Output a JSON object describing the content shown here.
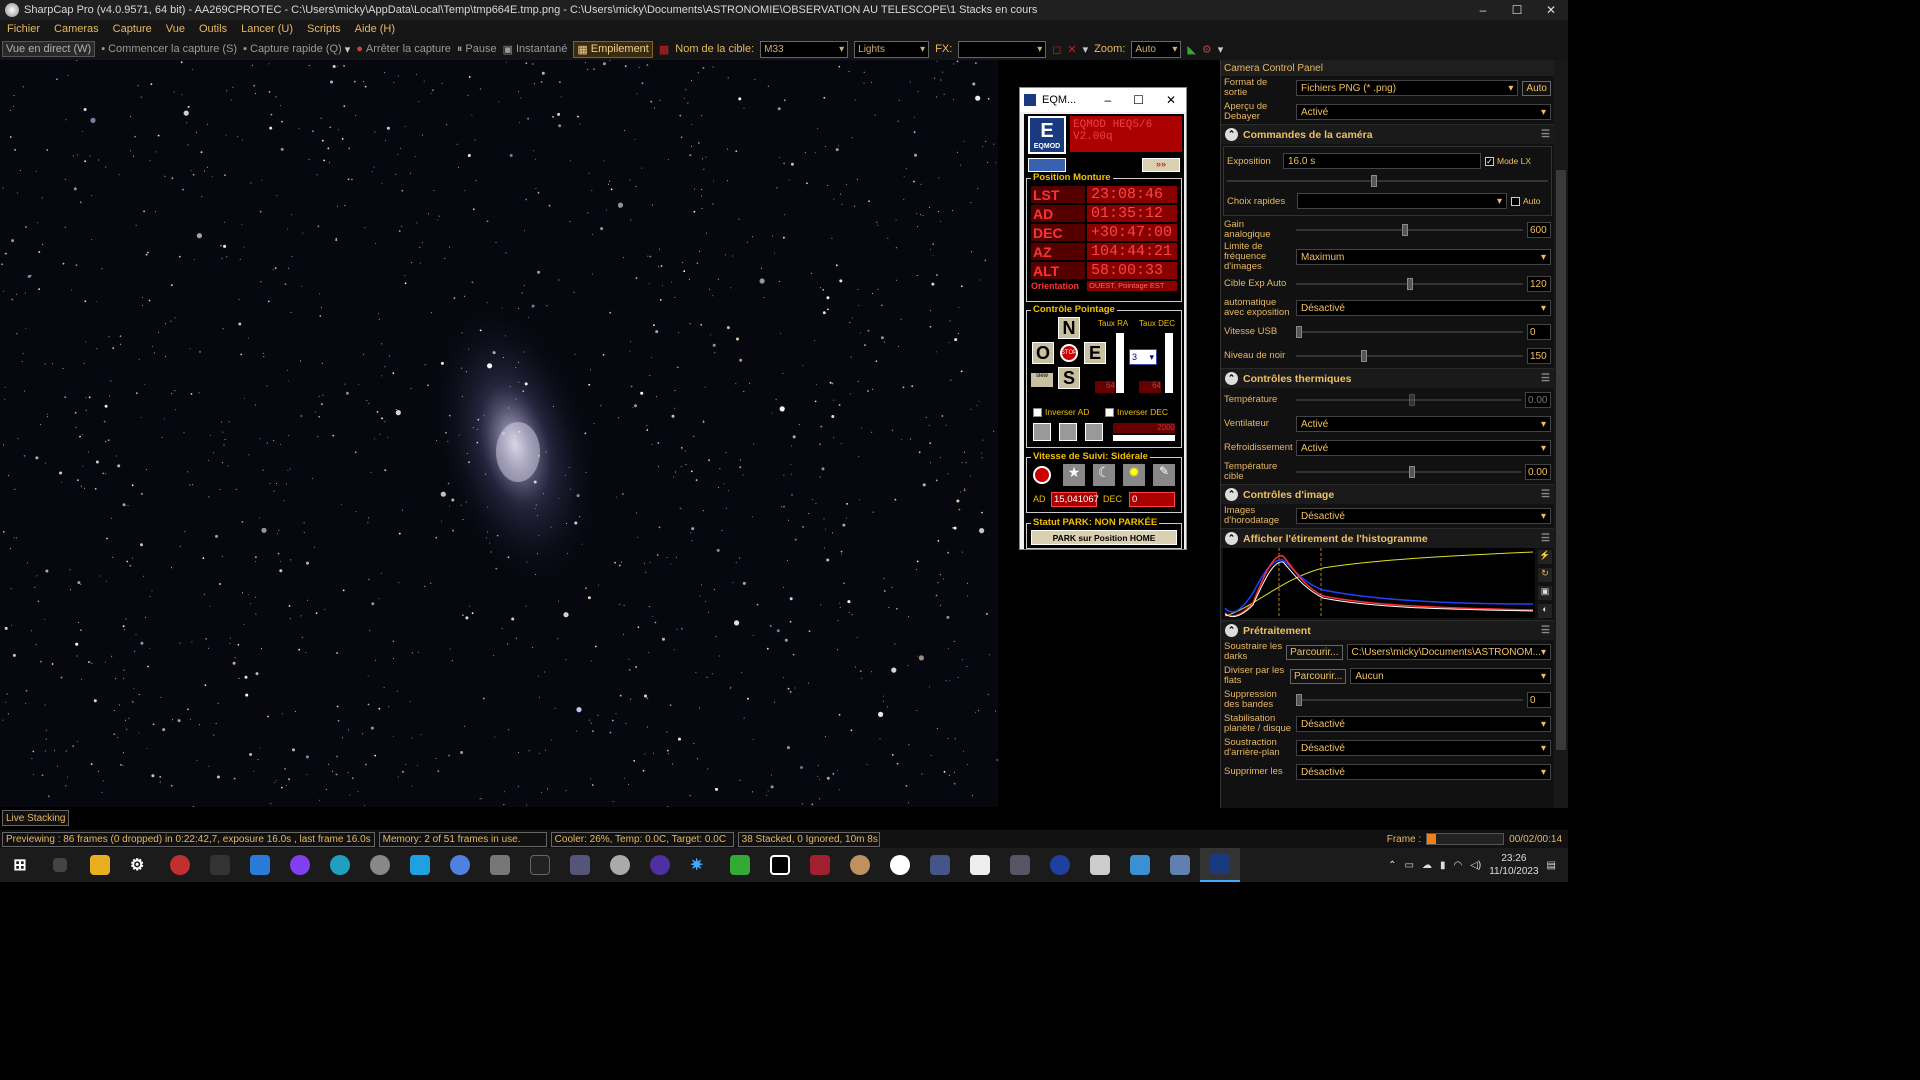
{
  "title": "SharpCap Pro (v4.0.9571, 64 bit) - AA269CPROTEC - C:\\Users\\micky\\AppData\\Local\\Temp\\tmp664E.tmp.png - C:\\Users\\micky\\Documents\\ASTRONOMIE\\OBSERVATION AU TELESCOPE\\1 Stacks en cours",
  "window_controls": {
    "minimize": "–",
    "maximize": "☐",
    "close": "✕"
  },
  "menu": [
    "Fichier",
    "Cameras",
    "Capture",
    "Vue",
    "Outils",
    "Lancer (U)",
    "Scripts",
    "Aide (H)"
  ],
  "toolbar": {
    "live_view": "Vue en direct (W)",
    "start_capture": "Commencer la capture (S)",
    "quick_capture": "Capture rapide (Q)",
    "stop_capture": "Arrêter la capture",
    "pause": "Pause",
    "snapshot": "Instantané",
    "stacking": "Empilement",
    "target_label": "Nom de la cible:",
    "target_value": "M33",
    "frame_type": "Lights",
    "fx_label": "FX:",
    "fx_value": "",
    "zoom_label": "Zoom:",
    "zoom_value": "Auto"
  },
  "side_panel": {
    "header": "Camera Control Panel",
    "output_format_label": "Format de sortie",
    "output_format_value": "Fichiers PNG (* .png)",
    "output_format_btn": "Auto",
    "debayer_label": "Aperçu de Debayer",
    "debayer_value": "Activé",
    "camera_section": "Commandes de la caméra",
    "exposure_label": "Exposition",
    "exposure_value": "16.0 s",
    "lx_mode": "Mode LX",
    "quick_choice_label": "Choix rapides",
    "auto_label": "Auto",
    "gain_label": "Gain analogique",
    "gain_value": "600",
    "gain_level": 0.48,
    "frame_rate_label": "Limite de fréquence d'images",
    "frame_rate_value": "Maximum",
    "auto_exp_label": "Cible Exp Auto",
    "auto_exp_value": "120",
    "auto_exp_level": 0.5,
    "auto_with_exp_label": "automatique avec exposition",
    "auto_with_exp_value": "Désactivé",
    "usb_label": "Vitesse USB",
    "usb_value": "0",
    "usb_level": 0.0,
    "black_label": "Niveau de noir",
    "black_value": "150",
    "black_level": 0.3,
    "thermal_section": "Contrôles thermiques",
    "temp_label": "Température",
    "temp_value": "0.00",
    "fan_label": "Ventilateur",
    "fan_value": "Activé",
    "cooling_label": "Refroidissement",
    "cooling_value": "Activé",
    "target_temp_label": "Température cible",
    "target_temp_value": "0.00",
    "image_section": "Contrôles d'image",
    "timestamp_label": "Images d'horodatage",
    "timestamp_value": "Désactivé",
    "histogram_section": "Afficher l'étirement de l'histogramme",
    "preprocess_section": "Prétraitement",
    "darks_label": "Soustraire les darks",
    "darks_btn": "Parcourir...",
    "darks_value": "C:\\Users\\micky\\Documents\\ASTRONOM...",
    "flats_label": "Diviser par les flats",
    "flats_btn": "Parcourir...",
    "flats_value": "Aucun",
    "banding_label": "Suppression des bandes",
    "banding_value": "0",
    "banding_level": 0.0,
    "stab_label": "Stabilisation planète / disque",
    "stab_value": "Désactivé",
    "bg_label": "Soustraction d'arrière-plan",
    "bg_value": "Désactivé",
    "remove_label": "Supprimer les",
    "remove_value": "Désactivé"
  },
  "eqmod": {
    "title": "EQM...",
    "logo": "E",
    "logo_sub": "EQMOD",
    "name_line1": "EQMOD HEQ5/6",
    "name_line2": "V2.00q",
    "position_group": "Position Monture",
    "rows": [
      {
        "label": "LST",
        "value": "23:08:46"
      },
      {
        "label": "AD",
        "value": "01:35:12"
      },
      {
        "label": "DEC",
        "value": "+30:47:00"
      },
      {
        "label": "AZ",
        "value": "104:44:21"
      },
      {
        "label": "ALT",
        "value": "58:00:33"
      }
    ],
    "orientation_label": "Orientation",
    "orientation_value": "OUEST, Pointage EST",
    "control_group": "Contrôle Pointage",
    "rate_ra_label": "Taux RA",
    "rate_dec_label": "Taux DEC",
    "north": "N",
    "south": "S",
    "east": "E",
    "west": "O",
    "stop": "STOP",
    "rate_value": "3",
    "ra_rate_num": "64",
    "dec_rate_num": "64",
    "invert_ad": "Inverser AD",
    "invert_dec": "Inverser DEC",
    "slew_num": "2000",
    "tracking_group": "Vitesse de Suivi: Sidérale",
    "ad_label": "AD",
    "ad_value": "15,041067",
    "dec_label": "DEC",
    "dec_value": "0",
    "park_group": "Statut PARK: NON PARKÉE",
    "park_button": "PARK sur Position HOME"
  },
  "live_stacking_tab": "Live Stacking",
  "status": {
    "preview": "Previewing : 86 frames (0 dropped) in 0:22:42,7, exposure 16.0s , last frame 16.0s",
    "memory": "Memory: 2 of 51 frames in use.",
    "cooler": "Cooler: 26%, Temp: 0.0C, Target: 0.0C",
    "stacked": "38 Stacked, 0 Ignored, 10m 8s",
    "frame_label": "Frame :",
    "frame_count": "00/02/00:14",
    "frame_progress": 0.12
  },
  "taskbar": {
    "time": "23:26",
    "date": "11/10/2023"
  },
  "colors": {
    "accent": "#e8b860",
    "led_red": "#aa0000",
    "histogram_red": "#ff3030",
    "histogram_blue": "#2040ff",
    "histogram_white": "#ffffff",
    "histogram_yellow": "#e0e020"
  }
}
